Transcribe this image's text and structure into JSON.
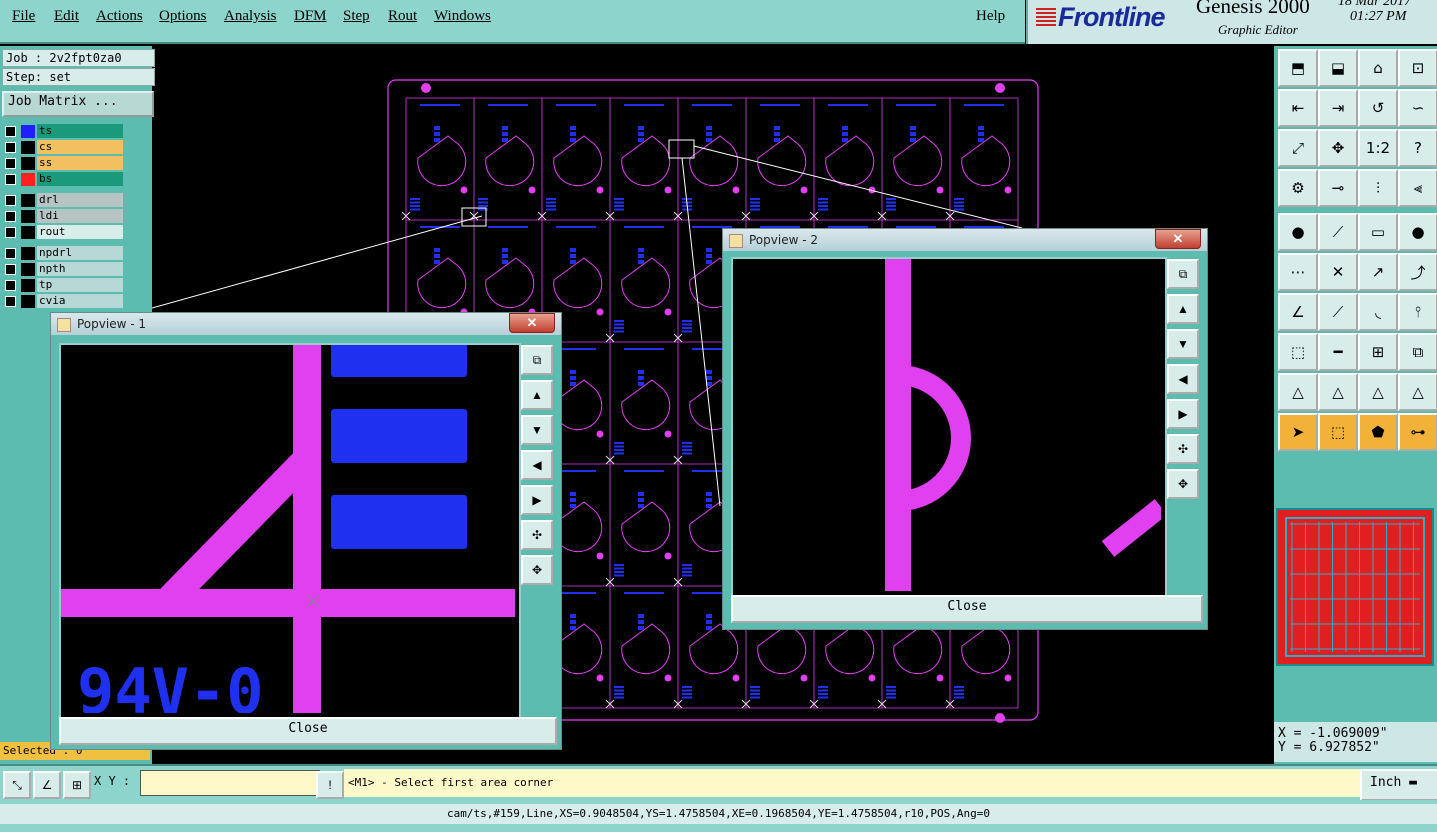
{
  "menu": {
    "items": [
      "File",
      "Edit",
      "Actions",
      "Options",
      "Analysis",
      "DFM",
      "Step",
      "Rout",
      "Windows"
    ],
    "help": "Help"
  },
  "brand": {
    "logo": "Frontline",
    "product": "Genesis 2000",
    "subtitle": "Graphic Editor",
    "date": "18 Mar 2017",
    "time": "01:27 PM"
  },
  "job": {
    "job_line": "Job : 2v2fpt0za0",
    "step_line": "Step: set",
    "matrix_button": "Job Matrix ..."
  },
  "layers": [
    {
      "name": "ts",
      "bg": "#1a9a7a",
      "swatch": "#2020ff"
    },
    {
      "name": "cs",
      "bg": "#f2c060",
      "swatch": "#000000"
    },
    {
      "name": "ss",
      "bg": "#f2c060",
      "swatch": "#000000"
    },
    {
      "name": "bs",
      "bg": "#1a9a7a",
      "swatch": "#ff2020"
    },
    {
      "name": "drl",
      "bg": "#b8c4c4",
      "swatch": "#000000"
    },
    {
      "name": "ldi",
      "bg": "#b8c4c4",
      "swatch": "#000000"
    },
    {
      "name": "rout",
      "bg": "#d8ecea",
      "swatch": "#000000"
    },
    {
      "name": "npdrl",
      "bg": "#b8d8d8",
      "swatch": "#000000"
    },
    {
      "name": "npth",
      "bg": "#b8d8d8",
      "swatch": "#000000"
    },
    {
      "name": "tp",
      "bg": "#b8d8d8",
      "swatch": "#000000"
    },
    {
      "name": "cvia",
      "bg": "#b8d8d8",
      "swatch": "#000000"
    }
  ],
  "selected_label": "Selected : 0",
  "coords": {
    "x": "X = -1.069009\"",
    "y": "Y = 6.927852\""
  },
  "bottom": {
    "xy_label": "X Y :",
    "xy_value": "",
    "prompt": "<M1> - Select first area corner",
    "units": "Inch"
  },
  "status": "cam/ts,#159,Line,XS=0.9048504,YS=1.4758504,XE=0.1968504,YE=1.4758504,r10,POS,Ang=0",
  "popview1": {
    "title": "Popview - 1",
    "close": "Close",
    "silk": "94V-0"
  },
  "popview2": {
    "title": "Popview - 2",
    "close": "Close"
  },
  "colors": {
    "trace": "#e040f0",
    "pad": "#2030f0",
    "panel": "#5cbcb0",
    "menu": "#8cd4cc"
  }
}
